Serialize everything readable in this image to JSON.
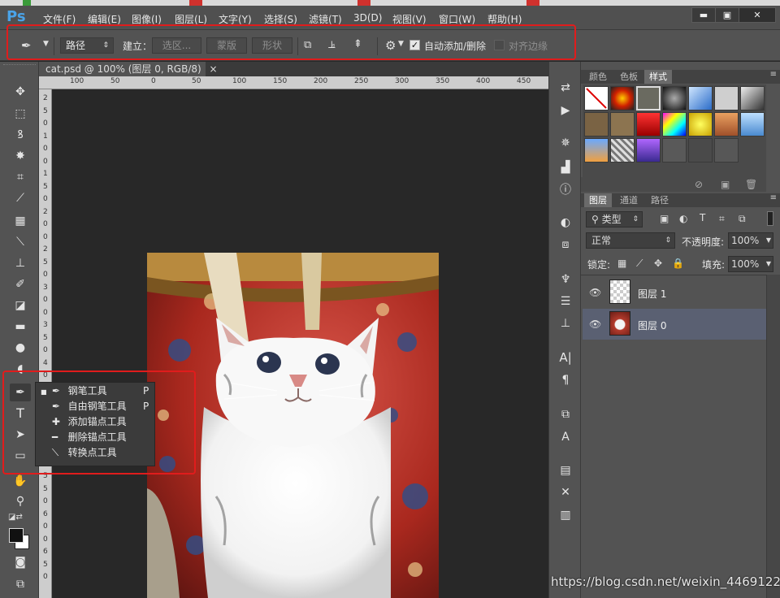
{
  "app": {
    "logo": "Ps"
  },
  "menu": [
    "文件(F)",
    "编辑(E)",
    "图像(I)",
    "图层(L)",
    "文字(Y)",
    "选择(S)",
    "滤镜(T)",
    "3D(D)",
    "视图(V)",
    "窗口(W)",
    "帮助(H)"
  ],
  "window_buttons": {
    "minimize": "▬",
    "maximize": "▣",
    "close": "✕"
  },
  "options": {
    "mode_select": "路径",
    "create_label": "建立：",
    "btn_selection": "选区...",
    "btn_mask": "蒙版",
    "btn_shape": "形状",
    "auto_add_label": "自动添加/删除",
    "auto_add_checked": true,
    "align_edges_label": "对齐边缘",
    "align_edges_checked": false
  },
  "document": {
    "tab_title": "cat.psd @ 100% (图层 0, RGB/8)",
    "close": "×",
    "ruler_h": [
      "100",
      "50",
      "0",
      "50",
      "100",
      "150",
      "200",
      "250",
      "300",
      "350",
      "400",
      "450"
    ],
    "ruler_v": [
      "2",
      "5",
      "0",
      "1",
      "0",
      "0",
      "1",
      "5",
      "0",
      "2",
      "0",
      "0",
      "2",
      "5",
      "0",
      "3",
      "0",
      "0",
      "3",
      "5",
      "0",
      "4",
      "0",
      "0",
      "4",
      "5",
      "0",
      "5",
      "0",
      "0",
      "5",
      "5",
      "0",
      "6",
      "0",
      "0",
      "6",
      "5",
      "0"
    ]
  },
  "tool_flyout": {
    "items": [
      {
        "label": "钢笔工具",
        "shortcut": "P",
        "selected": true
      },
      {
        "label": "自由钢笔工具",
        "shortcut": "P",
        "selected": false
      },
      {
        "label": "添加锚点工具",
        "shortcut": "",
        "selected": false
      },
      {
        "label": "删除锚点工具",
        "shortcut": "",
        "selected": false
      },
      {
        "label": "转换点工具",
        "shortcut": "",
        "selected": false
      }
    ]
  },
  "styles_panel": {
    "tabs": [
      "颜色",
      "色板",
      "样式"
    ],
    "active_tab": "样式"
  },
  "layers_panel": {
    "tabs": [
      "图层",
      "通道",
      "路径"
    ],
    "active_tab": "图层",
    "filter_label": "类型",
    "blend_mode": "正常",
    "opacity_label": "不透明度:",
    "opacity": "100%",
    "lock_label": "锁定:",
    "fill_label": "填充:",
    "fill": "100%",
    "layers": [
      {
        "name": "图层 1",
        "selected": false
      },
      {
        "name": "图层 0",
        "selected": true
      }
    ]
  },
  "watermark": "https://blog.csdn.net/weixin_44691220",
  "colors": {
    "highlight_box": "#e01c1c",
    "selected_layer": "#5a6072",
    "logo": "#4aa3e8"
  }
}
